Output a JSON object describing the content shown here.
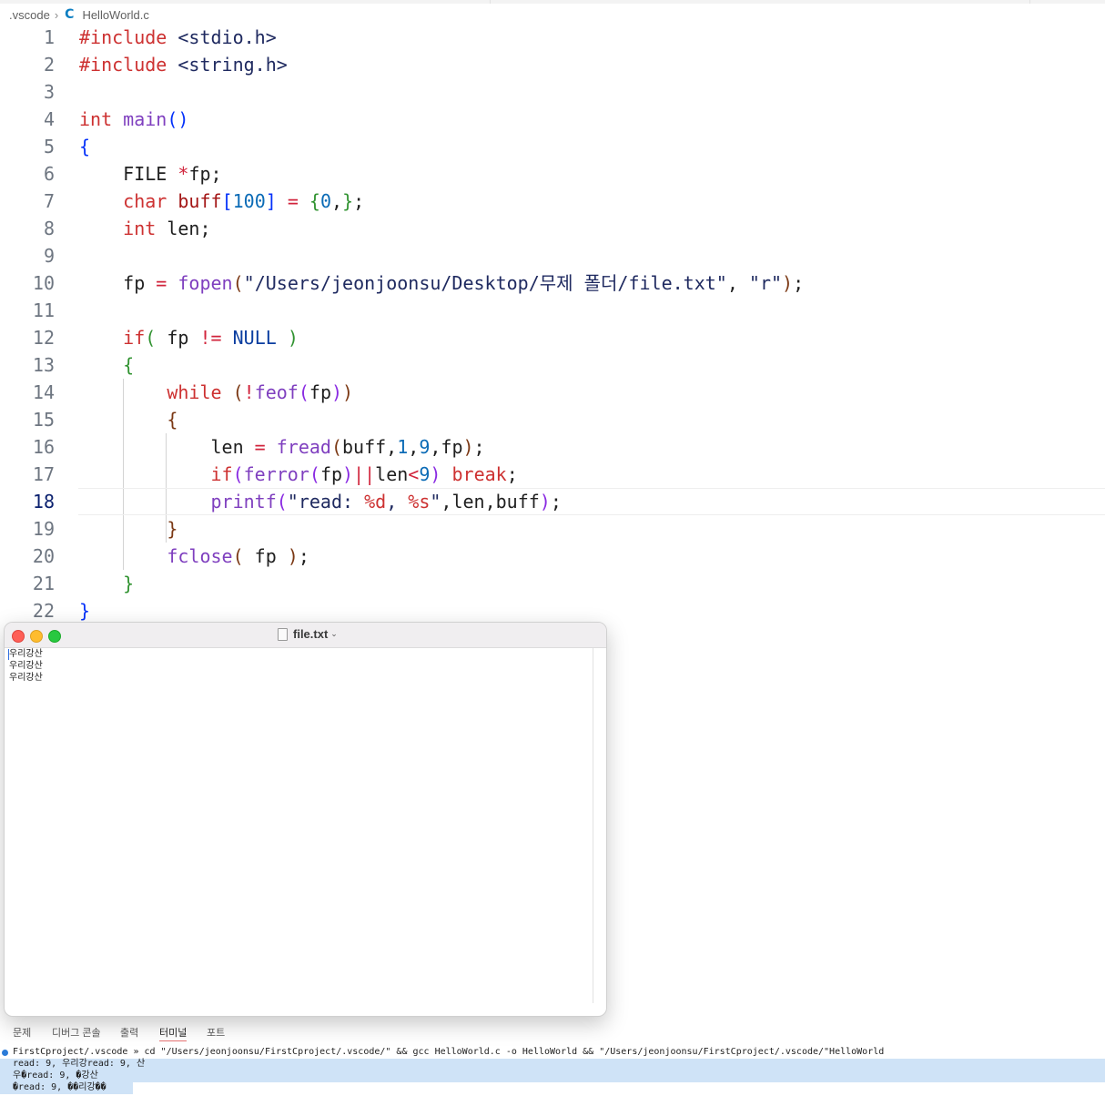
{
  "breadcrumb": {
    "folder": ".vscode",
    "file": "HelloWorld.c"
  },
  "editor": {
    "line_numbers": [
      "1",
      "2",
      "3",
      "4",
      "5",
      "6",
      "7",
      "8",
      "9",
      "10",
      "11",
      "12",
      "13",
      "14",
      "15",
      "16",
      "17",
      "18",
      "19",
      "20",
      "21",
      "22"
    ],
    "active_line": "18"
  },
  "textedit": {
    "title": "file.txt",
    "lines": [
      "우리강산",
      "우리강산",
      "우리강산"
    ]
  },
  "panel": {
    "tabs": [
      "문제",
      "디버그 콘솔",
      "출력",
      "터미널",
      "포트"
    ],
    "active_tab": "터미널"
  },
  "terminal": {
    "command_line": "FirstCproject/.vscode » cd \"/Users/jeonjoonsu/FirstCproject/.vscode/\" && gcc HelloWorld.c -o HelloWorld && \"/Users/jeonjoonsu/FirstCproject/.vscode/\"HelloWorld",
    "output": [
      "read: 9, 우리강read: 9, 산",
      "우�read: 9, �강산",
      "�read: 9, ��리강��"
    ]
  },
  "colors": {
    "keyword": "#cd3131",
    "function": "#7f3fbf",
    "number": "#0b6bb6",
    "terminal_selection": "#cfe3f7"
  }
}
